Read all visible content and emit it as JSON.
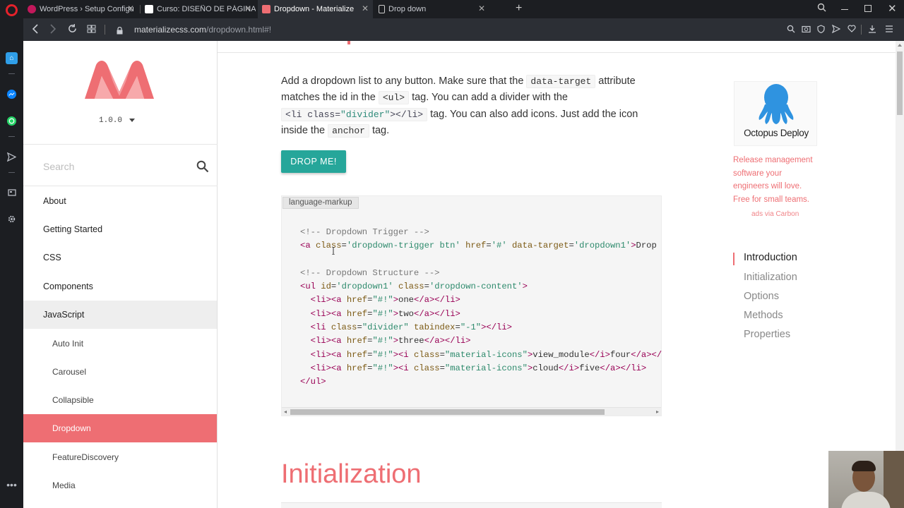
{
  "browser": {
    "tabs": [
      {
        "label": "WordPress › Setup Configu",
        "fav_color": "#c2185b"
      },
      {
        "label": "Curso: DISEÑO DE PÁGINA…",
        "fav_color": "#ffffff"
      },
      {
        "label": "Dropdown - Materialize",
        "fav_color": "#ee6e73"
      },
      {
        "label": "Drop down",
        "fav_color": "#cccccc"
      }
    ],
    "new_tab": "+",
    "url_host": "materializecss.com",
    "url_path": "/dropdown.html#!",
    "close_glyph": "✕"
  },
  "sidenav": {
    "version": "1.0.0",
    "search_placeholder": "Search",
    "items": [
      {
        "label": "About"
      },
      {
        "label": "Getting Started"
      },
      {
        "label": "CSS"
      },
      {
        "label": "Components"
      },
      {
        "label": "JavaScript"
      },
      {
        "label": "Auto Init"
      },
      {
        "label": "Carousel"
      },
      {
        "label": "Collapsible"
      },
      {
        "label": "Dropdown"
      },
      {
        "label": "FeatureDiscovery"
      },
      {
        "label": "Media"
      }
    ]
  },
  "content": {
    "desc_1": "Add a dropdown list to any button. Make sure that the",
    "code_data_target": "data-target",
    "desc_2": "attribute matches the id in the",
    "code_ul": "<ul>",
    "desc_3": "tag. You can add a divider with the",
    "desc_4": "tag. You can also add icons. Just add the icon inside the",
    "code_anchor": "anchor",
    "desc_5": "tag.",
    "button_label": "DROP ME!",
    "lang_tag": "language-markup",
    "section_heading": "Initialization"
  },
  "ad": {
    "brand": "Octopus Deploy",
    "text": "Release management software your engineers will love. Free for small teams.",
    "via": "ads via Carbon"
  },
  "toc": {
    "items": [
      {
        "label": "Introduction"
      },
      {
        "label": "Initialization"
      },
      {
        "label": "Options"
      },
      {
        "label": "Methods"
      },
      {
        "label": "Properties"
      }
    ]
  }
}
